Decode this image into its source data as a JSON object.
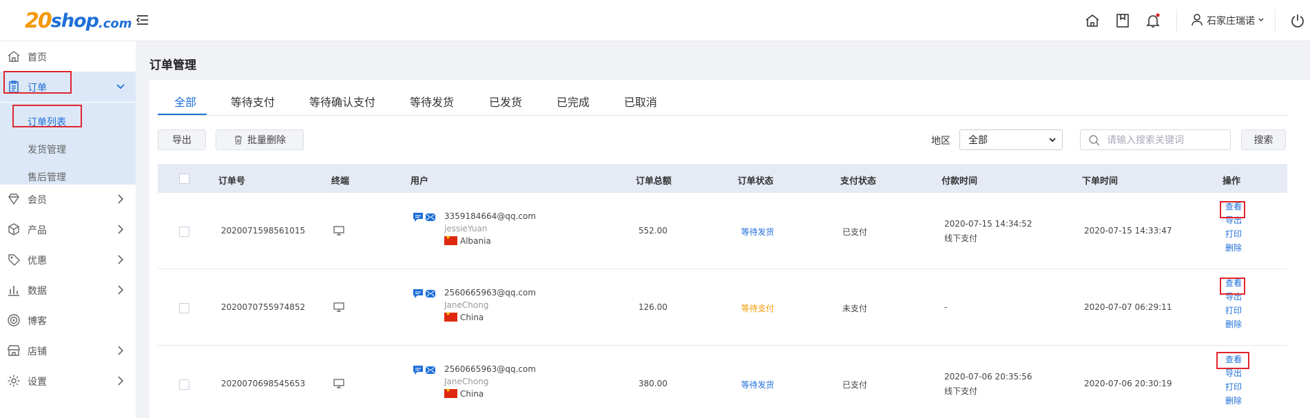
{
  "logo": {
    "num": "20",
    "shop": "shop",
    "com": ".com"
  },
  "header": {
    "username": "石家庄瑞诺"
  },
  "sidebar": {
    "items": [
      {
        "label": "首页",
        "icon": "home-icon"
      },
      {
        "label": "订单",
        "icon": "clipboard-icon"
      },
      {
        "label": "会员",
        "icon": "diamond-icon"
      },
      {
        "label": "产品",
        "icon": "box-icon"
      },
      {
        "label": "优惠",
        "icon": "tag-icon"
      },
      {
        "label": "数据",
        "icon": "bar-chart-icon"
      },
      {
        "label": "博客",
        "icon": "target-icon"
      },
      {
        "label": "店铺",
        "icon": "store-icon"
      },
      {
        "label": "设置",
        "icon": "gear-icon"
      }
    ],
    "sub_items": [
      {
        "label": "订单列表"
      },
      {
        "label": "发货管理"
      },
      {
        "label": "售后管理"
      }
    ]
  },
  "page": {
    "title": "订单管理"
  },
  "tabs": [
    {
      "label": "全部"
    },
    {
      "label": "等待支付"
    },
    {
      "label": "等待确认支付"
    },
    {
      "label": "等待发货"
    },
    {
      "label": "已发货"
    },
    {
      "label": "已完成"
    },
    {
      "label": "已取消"
    }
  ],
  "toolbar": {
    "export_label": "导出",
    "batch_delete_label": "批量删除",
    "region_label": "地区",
    "region_value": "全部",
    "search_placeholder": "请输入搜索关键词",
    "search_button": "搜索"
  },
  "table": {
    "headers": [
      "订单号",
      "终端",
      "用户",
      "订单总额",
      "订单状态",
      "支付状态",
      "付款时间",
      "下单时间",
      "操作"
    ],
    "rows": [
      {
        "order_no": "2020071598561015",
        "email": "3359184664@qq.com",
        "username": "jessieYuan",
        "country": "Albania",
        "total": "552.00",
        "order_status": "等待发货",
        "pay_status": "已支付",
        "pay_time": "2020-07-15 14:34:52",
        "pay_method": "线下支付",
        "order_time": "2020-07-15 14:33:47"
      },
      {
        "order_no": "2020070755974852",
        "email": "2560665963@qq.com",
        "username": "JaneChong",
        "country": "China",
        "total": "126.00",
        "order_status": "等待支付",
        "pay_status": "未支付",
        "pay_time": "-",
        "pay_method": "",
        "order_time": "2020-07-07 06:29:11"
      },
      {
        "order_no": "2020070698545653",
        "email": "2560665963@qq.com",
        "username": "JaneChong",
        "country": "China",
        "total": "380.00",
        "order_status": "等待发货",
        "pay_status": "已支付",
        "pay_time": "2020-07-06 20:35:56",
        "pay_method": "线下支付",
        "order_time": "2020-07-06 20:30:19"
      }
    ],
    "actions": {
      "view": "查看",
      "export": "导出",
      "print": "打印",
      "delete": "删除"
    }
  },
  "colors": {
    "accent": "#1e6fd9",
    "orange": "#f39800",
    "highlight": "#e0242b"
  }
}
